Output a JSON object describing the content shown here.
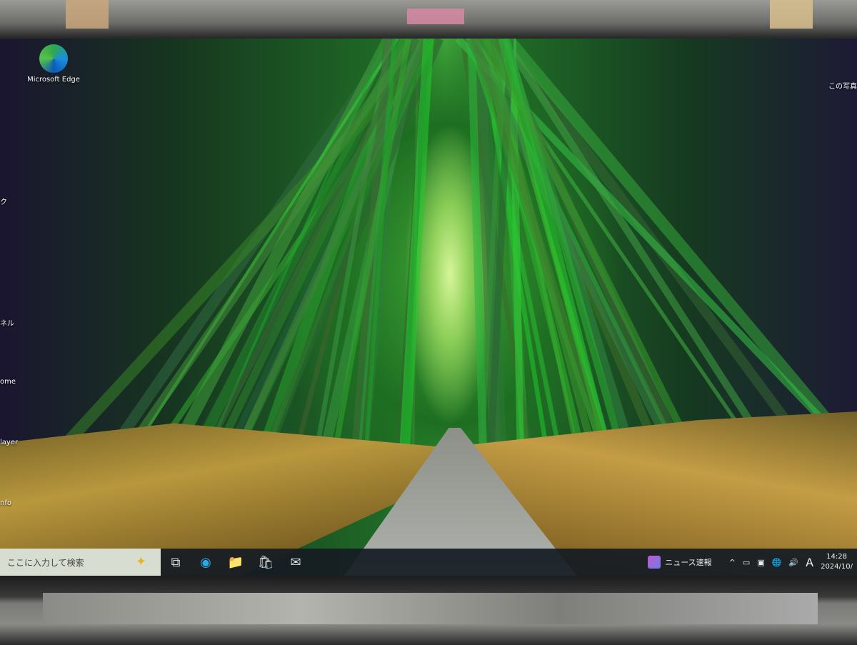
{
  "desktop": {
    "icons": [
      {
        "label": "Microsoft Edge",
        "icon": "edge-icon"
      }
    ],
    "partial_labels": [
      "ク",
      "ネル",
      "ome",
      "layer",
      "nfo"
    ],
    "top_right_text": "この写真"
  },
  "taskbar": {
    "search_placeholder": "ここに入力して検索",
    "apps": [
      {
        "name": "task-view",
        "glyph": "⧉"
      },
      {
        "name": "edge",
        "glyph": "◉"
      },
      {
        "name": "file-explorer",
        "glyph": "📁"
      },
      {
        "name": "microsoft-store",
        "glyph": "🛍"
      },
      {
        "name": "mail",
        "glyph": "✉"
      }
    ],
    "news_label": "ニュース速報",
    "tray": {
      "chevron": "^",
      "ime": "A",
      "volume": "🔊",
      "network": "🌐"
    },
    "time": "14:28",
    "date": "2024/10/"
  }
}
